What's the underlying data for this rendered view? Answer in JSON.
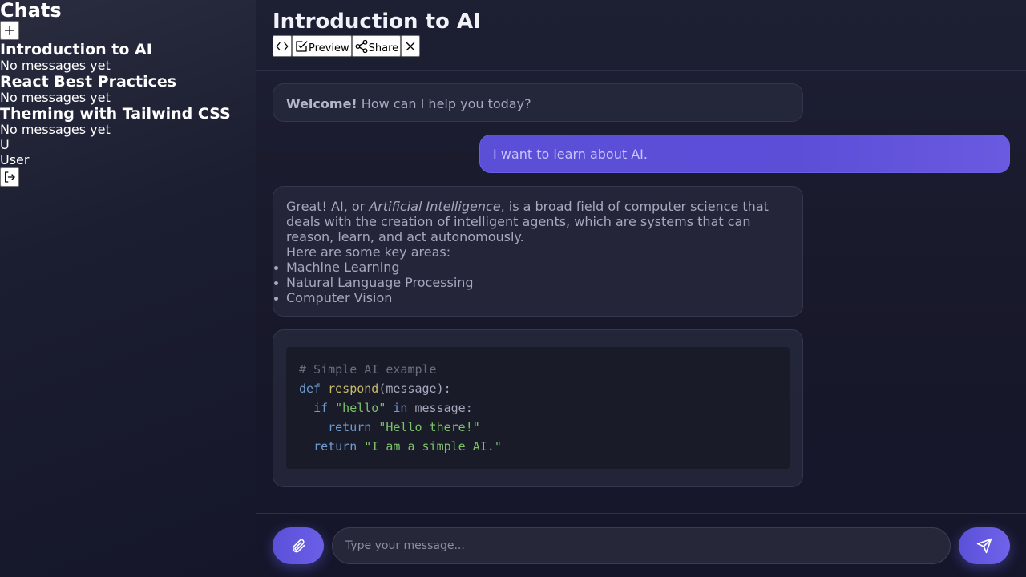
{
  "sidebar": {
    "title": "Chats",
    "new_chat_icon": "plus-icon",
    "chats": [
      {
        "title": "Introduction to AI",
        "preview": "No messages yet"
      },
      {
        "title": "React Best Practices",
        "preview": "No messages yet"
      },
      {
        "title": "Theming with Tailwind CSS",
        "preview": "No messages yet"
      }
    ],
    "user": {
      "avatar": "U",
      "name": "User"
    },
    "logout_icon": "logout-icon"
  },
  "header": {
    "title": "Introduction to AI",
    "toolbar": {
      "code_icon": "code-icon",
      "preview_label": "Preview",
      "preview_icon": "checkbox-pen-icon",
      "share_label": "Share",
      "share_icon": "share-icon",
      "close_icon": "close-icon"
    }
  },
  "messages": [
    {
      "role": "assistant",
      "bold": "Welcome!",
      "text": " How can I help you today?"
    },
    {
      "role": "user",
      "text": "I want to learn about AI."
    },
    {
      "role": "assistant",
      "intro_a": "Great! AI, or ",
      "intro_em": "Artificial Intelligence",
      "intro_b": ", is a broad field of computer science that deals with the creation of intelligent agents, which are systems that can reason, learn, and act autonomously.",
      "areas_label": "Here are some key areas:",
      "areas": [
        "Machine Learning",
        "Natural Language Processing",
        "Computer Vision"
      ]
    },
    {
      "role": "assistant",
      "code": {
        "comment": "# Simple AI example",
        "def_kw": "def",
        "fn_name": "respond",
        "fn_args": "(message):",
        "if_kw": "if",
        "if_str": "\"hello\"",
        "in_kw": "in",
        "if_rest": "message:",
        "return_kw": "return",
        "ret1_str": "\"Hello there!\"",
        "ret2_str": "\"I am a simple AI.\""
      }
    }
  ],
  "composer": {
    "attach_icon": "paperclip-icon",
    "placeholder": "Type your message...",
    "send_icon": "send-icon"
  },
  "colors": {
    "accent": "#5d4ed8",
    "background": "#15162a",
    "bubble": "#282a3e"
  }
}
